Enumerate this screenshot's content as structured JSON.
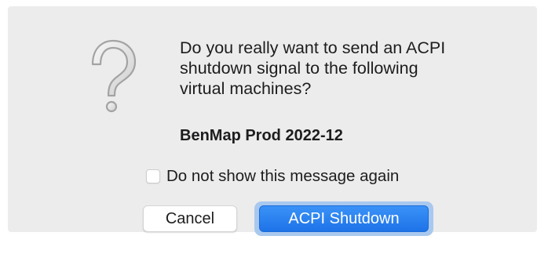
{
  "dialog": {
    "icon": "question-mark-icon",
    "message": "Do you really want to send an ACPI shutdown signal to the following virtual machines?",
    "message_lines": [
      "Do you really want to send an ACPI",
      "shutdown signal to the following",
      "virtual machines?"
    ],
    "vm_name": "BenMap Prod 2022-12",
    "checkbox_label": "Do not show this message again",
    "checkbox_checked": false,
    "cancel_label": "Cancel",
    "confirm_label": "ACPI Shutdown"
  },
  "colors": {
    "dialog_background": "#ececec",
    "primary_button": "#1e73e8",
    "focus_ring": "#a9c8ee"
  }
}
